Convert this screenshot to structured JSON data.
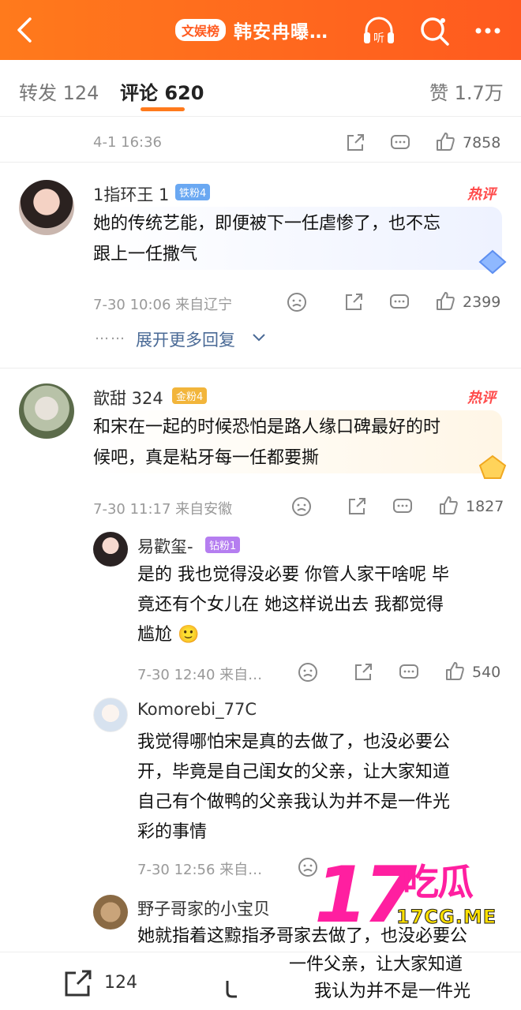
{
  "header": {
    "tag": "文娱榜",
    "title": "韩安冉曝…",
    "back_icon": "back-arrow-icon",
    "listen_label": "听",
    "colors": {
      "accent": "#ff6a1e"
    }
  },
  "tabs": {
    "repost_label": "转发 124",
    "comment_label": "评论 620",
    "like_label": "赞 1.7万"
  },
  "top_post": {
    "time": "4-1 16:36",
    "like_count": "7858"
  },
  "comments": [
    {
      "user": "1指环王 1",
      "badge": "铁粉4",
      "hot": "热评",
      "text_line1": "她的传统艺能，即便被下一任虐惨了，也不忘",
      "text_line2": "跟上一任撒气",
      "meta": "7-30 10:06  来自辽宁",
      "likes": "2399",
      "more_replies": "展开更多回复"
    },
    {
      "user": "歆甜 324",
      "badge": "金粉4",
      "hot": "热评",
      "text_line1": "和宋在一起的时候恐怕是路人缘口碑最好的时",
      "text_line2": "候吧，真是粘牙每一任都要撕",
      "meta": "7-30 11:17  来自安徽",
      "likes": "1827",
      "replies": [
        {
          "user": "易歡玺-",
          "badge": "钻粉1",
          "line1": "是的 我也觉得没必要 你管人家干啥呢 毕",
          "line2": "竟还有个女儿在 她这样说出去 我都觉得",
          "line3": "尴尬 🙂",
          "meta": "7-30 12:40  来自…",
          "likes": "540"
        },
        {
          "user": "Komorebi_77C",
          "line1": "我觉得哪怕宋是真的去做了，也没必要公",
          "line2": "开，毕竟是自己闺女的父亲，让大家知道",
          "line3": "自己有个做鸭的父亲我认为并不是一件光",
          "line4": "彩的事情",
          "meta": "7-30 12:56  来自…"
        },
        {
          "user": "野子哥家的小宝贝",
          "line1": "她就指着这黥指矛哥家去做了，也没必要公",
          "line2": "一件父亲，让大家知道",
          "line3": "我认为并不是一件光"
        }
      ]
    }
  ],
  "bottom": {
    "repost_count": "124"
  },
  "watermark": {
    "number": "17",
    "cn": "吃瓜",
    "url": "17CG.ME"
  }
}
